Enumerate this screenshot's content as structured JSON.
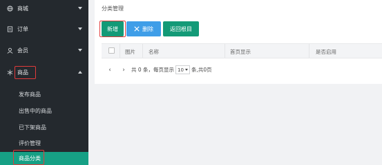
{
  "sidebar": {
    "sections": [
      {
        "label": "商城",
        "icon": "globe-icon"
      },
      {
        "label": "订单",
        "icon": "orders-icon"
      },
      {
        "label": "会员",
        "icon": "user-icon"
      },
      {
        "label": "商品",
        "icon": "snowflake-icon"
      }
    ],
    "subitems": [
      {
        "label": "发布商品"
      },
      {
        "label": "出售中的商品"
      },
      {
        "label": "已下架商品"
      },
      {
        "label": "评价管理"
      },
      {
        "label": "商品分类"
      }
    ]
  },
  "header": {
    "breadcrumb": "分类管理"
  },
  "toolbar": {
    "add_label": "新增",
    "delete_label": "删除",
    "back_label": "返回根目"
  },
  "table": {
    "columns": [
      "图片",
      "名称",
      "首页显示",
      "是否启用"
    ]
  },
  "pager": {
    "text_before": "共 0 条，每页显示",
    "page_size": "10",
    "text_after": "条,共0页"
  }
}
